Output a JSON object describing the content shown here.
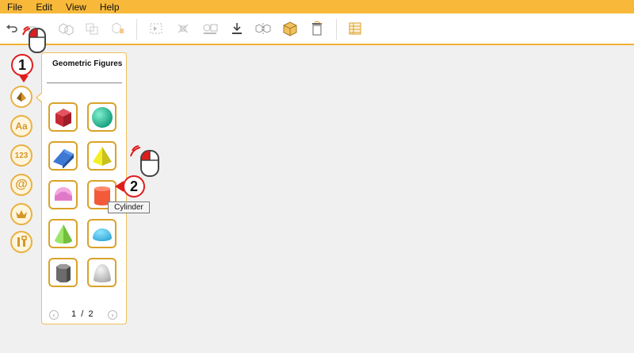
{
  "menu": {
    "file": "File",
    "edit": "Edit",
    "view": "View",
    "help": "Help"
  },
  "toolbar": {
    "icons": [
      "undo-icon",
      "redo-icon",
      "copy-3d-icon",
      "duplicate-icon",
      "paste-icon",
      "select-icon",
      "transform-icon",
      "group-icon",
      "export-icon",
      "flip-icon",
      "box-icon",
      "delete-icon",
      "spreadsheet-icon"
    ]
  },
  "sidebar": {
    "text_label": "Aa",
    "numbers_label": "123",
    "at_label": "@"
  },
  "panel": {
    "title": "Geometric Figures",
    "shapes": [
      "Cube",
      "Sphere",
      "Wedge",
      "Pyramid",
      "Half Cylinder",
      "Cylinder",
      "Cone",
      "Hemisphere",
      "Hexagonal Prism",
      "Paraboloid"
    ],
    "page_current": "1",
    "page_sep": "/",
    "page_total": "2"
  },
  "tooltip": "Cylinder",
  "callouts": {
    "one": "1",
    "two": "2"
  },
  "colors": {
    "accent": "#f8b93a",
    "tile_border": "#d9a22a",
    "callout": "#e01c1c"
  }
}
